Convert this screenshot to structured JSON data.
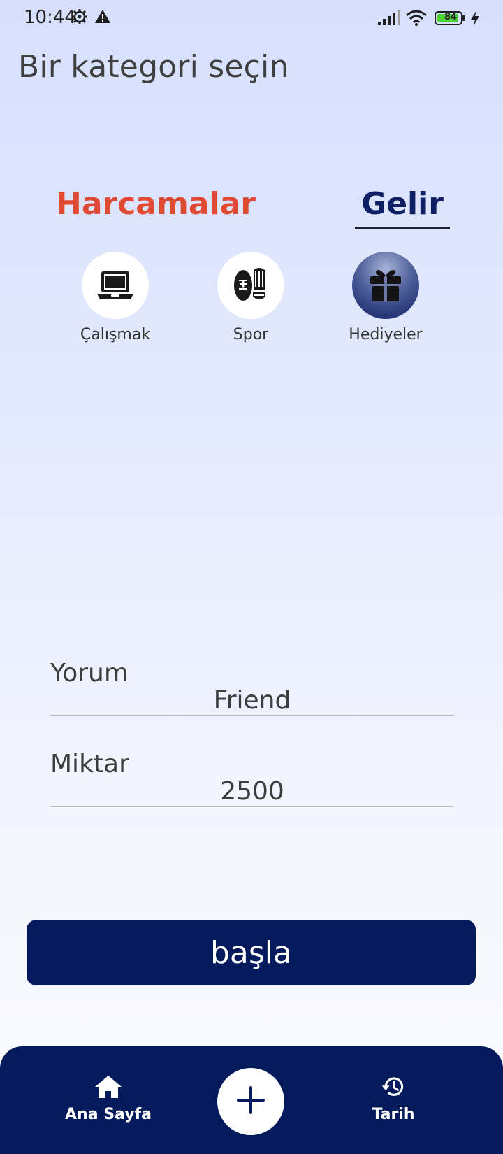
{
  "status_bar": {
    "time": "10:44",
    "battery": "84"
  },
  "header": {
    "title": "Bir kategori seçin"
  },
  "tabs": [
    {
      "label": "Harcamalar",
      "color": "#e04a32"
    },
    {
      "label": "Gelir",
      "color": "#0f1f63",
      "selected": true
    }
  ],
  "categories": [
    {
      "label": "Çalışmak",
      "icon": "laptop-icon"
    },
    {
      "label": "Spor",
      "icon": "sport-shoes-icon"
    },
    {
      "label": "Hediyeler",
      "icon": "gift-icon",
      "selected": true
    }
  ],
  "form": {
    "comment_label": "Yorum",
    "comment_value": "Friend",
    "amount_label": "Miktar",
    "amount_value": "2500"
  },
  "start_button": {
    "label": "başla"
  },
  "bottom_nav": {
    "home_label": "Ana Sayfa",
    "history_label": "Tarih",
    "add_icon": "plus-icon"
  },
  "colors": {
    "primary": "#031a5c",
    "accent": "#e04a32"
  }
}
